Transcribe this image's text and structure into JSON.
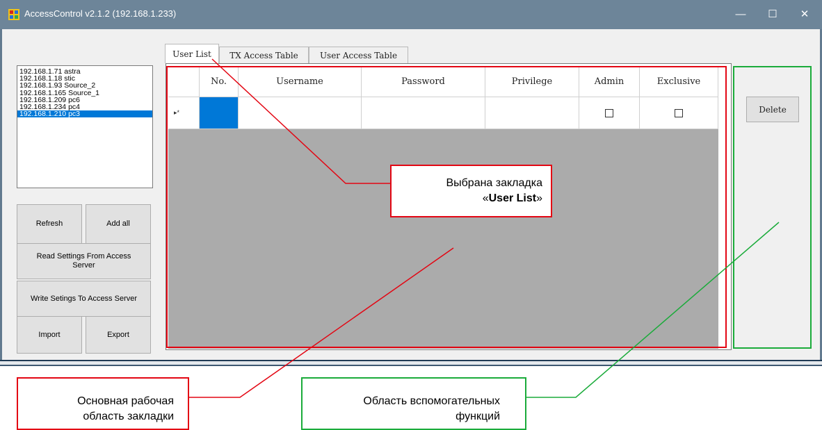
{
  "window": {
    "title": "AccessControl v2.1.2 (192.168.1.233)"
  },
  "sidebar": {
    "ip_list": [
      {
        "label": "192.168.1.71 astra",
        "selected": false
      },
      {
        "label": "192.168.1.18 stic",
        "selected": false
      },
      {
        "label": "192.168.1.93 Source_2",
        "selected": false
      },
      {
        "label": "192.168.1.165 Source_1",
        "selected": false
      },
      {
        "label": "192.168.1.209 pc6",
        "selected": false
      },
      {
        "label": "192.168.1.234 pc4",
        "selected": false
      },
      {
        "label": "192.168.1.210 pc3",
        "selected": true
      }
    ],
    "buttons": {
      "refresh": "Refresh",
      "add_all": "Add all",
      "read": "Read Settings From Access Server",
      "write": "Write Setings To Access Server",
      "import": "Import",
      "export": "Export"
    }
  },
  "tabs": [
    "User List",
    "TX Access Table",
    "User Access Table"
  ],
  "active_tab": "User List",
  "grid": {
    "columns": [
      "No.",
      "Username",
      "Password",
      "Privilege",
      "Admin",
      "Exclusive"
    ],
    "new_row_marker": "▸*",
    "new_row": {
      "admin_checked": false,
      "exclusive_checked": false
    }
  },
  "side": {
    "delete_label": "Delete"
  },
  "annotations": {
    "tab_callout_line1": "Выбрана закладка",
    "tab_callout_quote_open": "«",
    "tab_callout_bold": "User List",
    "tab_callout_quote_close": "»",
    "main_area_line1": "Основная рабочая",
    "main_area_line2": "область закладки",
    "aux_area_line1": "Область вспомогательных",
    "aux_area_line2": "функций"
  },
  "colors": {
    "titlebar": "#6d8599",
    "selection": "#0078d7",
    "annotation_red": "#e30613",
    "annotation_green": "#1aab3a"
  }
}
